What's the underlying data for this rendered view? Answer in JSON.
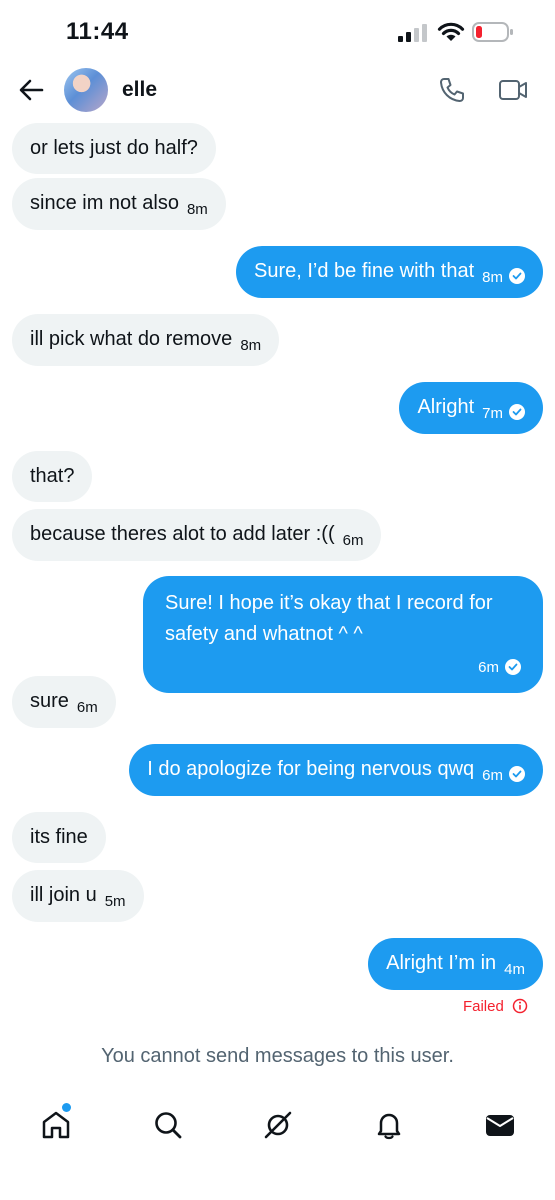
{
  "status_bar": {
    "time": "11:44"
  },
  "header": {
    "contact_name": "elle",
    "back_icon": "arrow-left-icon",
    "call_icon": "phone-icon",
    "video_icon": "video-camera-icon"
  },
  "messages": [
    {
      "direction": "in",
      "text": "or lets just do half?",
      "time": ""
    },
    {
      "direction": "in",
      "text": "since im not also",
      "time": "8m"
    },
    {
      "direction": "out",
      "text": "Sure, I’d be fine with that",
      "time": "8m"
    },
    {
      "direction": "in",
      "text": "ill pick what do remove",
      "time": "8m"
    },
    {
      "direction": "out",
      "text": "Alright",
      "time": "7m"
    },
    {
      "direction": "in",
      "text": "that?",
      "time": ""
    },
    {
      "direction": "in",
      "text": "because theres alot to add later :((",
      "time": "6m"
    },
    {
      "direction": "out",
      "text": "Sure! I hope it’s okay that I record for safety and whatnot ^ ^",
      "time": "6m"
    },
    {
      "direction": "in",
      "text": "sure",
      "time": "6m"
    },
    {
      "direction": "out",
      "text": "I do apologize for being nervous qwq",
      "time": "6m"
    },
    {
      "direction": "in",
      "text": "its fine",
      "time": ""
    },
    {
      "direction": "in",
      "text": "ill join u",
      "time": "5m"
    },
    {
      "direction": "out",
      "text": "Alright I’m in",
      "time": "4m"
    }
  ],
  "failed_label": "Failed",
  "notice": "You cannot send messages to this user.",
  "bottom_nav": [
    "home-icon",
    "search-icon",
    "grok-icon",
    "notifications-bell-icon",
    "messages-envelope-icon"
  ],
  "colors": {
    "accent": "#1d9bf0",
    "incoming_bubble": "#eff3f4",
    "error": "#f4212e",
    "muted_text": "#536471"
  }
}
